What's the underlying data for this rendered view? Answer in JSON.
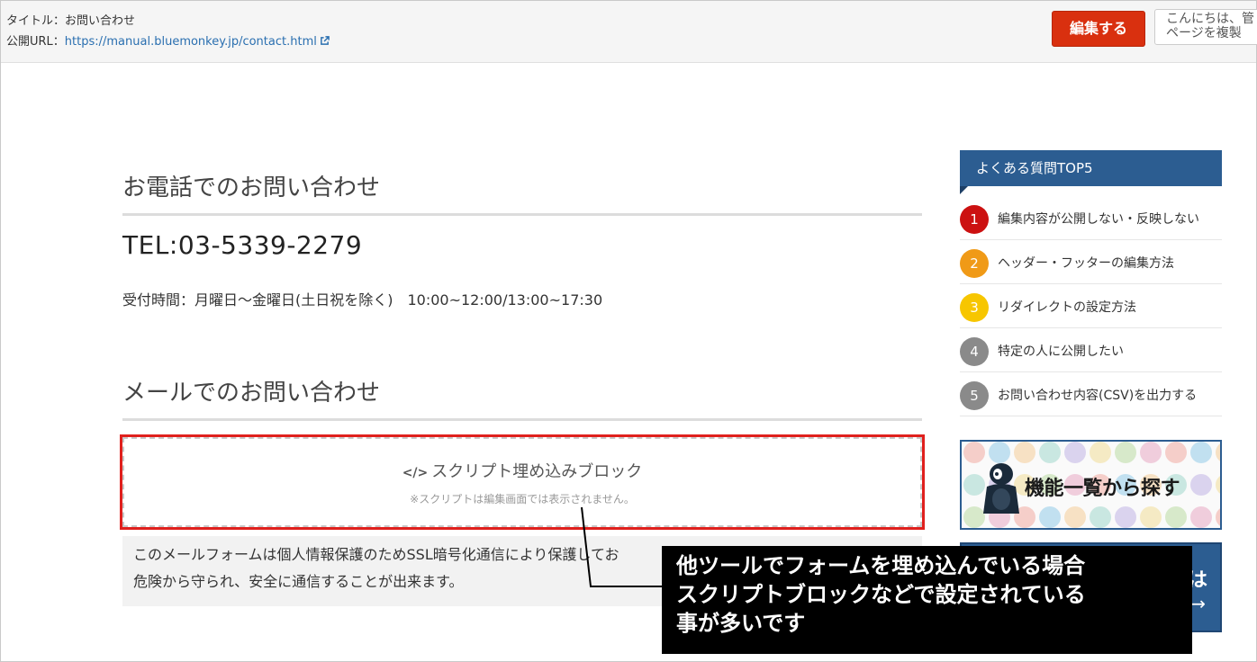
{
  "topbar": {
    "title_label": "タイトル：",
    "title_value": "お問い合わせ",
    "url_label": "公開URL：",
    "url_value": "https://manual.bluemonkey.jp/contact.html",
    "edit_button": "編集する",
    "user_line1": "こんにちは、管",
    "user_line2": "ページを複製"
  },
  "main": {
    "phone_heading": "お電話でのお問い合わせ",
    "tel": "TEL:03-5339-2279",
    "hours": "受付時間：月曜日～金曜日(土日祝を除く)　10:00~12:00/13:00~17:30",
    "mail_heading": "メールでのお問い合わせ",
    "script_block_code": "</>",
    "script_block_title": "スクリプト埋め込みブロック",
    "script_block_note": "※スクリプトは編集画面では表示されません。",
    "mail_note_line1": "このメールフォームは個人情報保護のためSSL暗号化通信により保護してお",
    "mail_note_line2": "危険から守られ、安全に通信することが出来ます。"
  },
  "sidebar": {
    "faq_title": "よくある質問TOP5",
    "faq_items": [
      {
        "num": "1",
        "text": "編集内容が公開しない・反映しない",
        "color": "#cc1111"
      },
      {
        "num": "2",
        "text": "ヘッダー・フッターの編集方法",
        "color": "#f09a17"
      },
      {
        "num": "3",
        "text": "リダイレクトの設定方法",
        "color": "#f7c600"
      },
      {
        "num": "4",
        "text": "特定の人に公開したい",
        "color": "#8a8a8a"
      },
      {
        "num": "5",
        "text": "お問い合わせ内容(CSV)を出力する",
        "color": "#8a8a8a"
      }
    ],
    "banner_text": "機能一覧から探す",
    "banner2_fragment1": "は",
    "banner2_fragment2": "→"
  },
  "annotation": {
    "line1": "他ツールでフォームを埋め込んでいる場合",
    "line2": "スクリプトブロックなどで設定されている",
    "line3": "事が多いです"
  },
  "colors": {
    "accent_red": "#d9300f",
    "highlight_red": "#e0201d",
    "sidebar_blue": "#2c5d91",
    "link_blue": "#2a6fb0"
  }
}
